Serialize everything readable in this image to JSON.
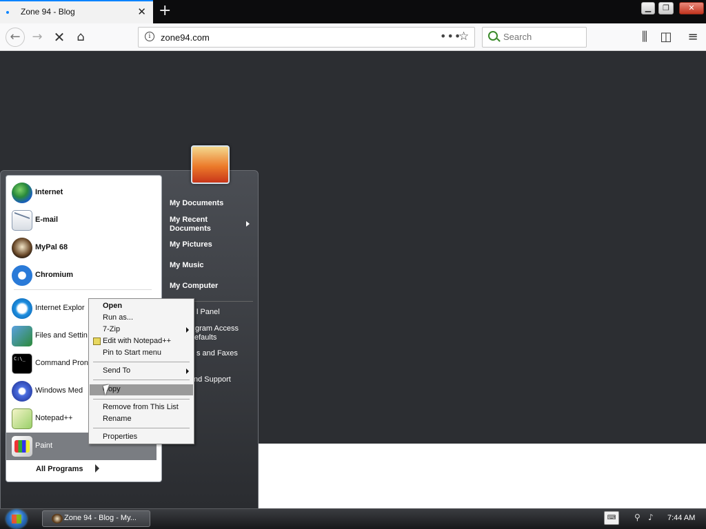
{
  "browser": {
    "tab_title": "Zone 94 - Blog",
    "tab_close": "✕",
    "new_tab": "+",
    "url": "zone94.com",
    "url_actions": "•••",
    "bookmark_star": "☆",
    "search_placeholder": "Search",
    "window_controls": {
      "minimize": "▁",
      "maximize": "❐",
      "close": "✕"
    },
    "nav_icons": {
      "back": "←",
      "forward": "→",
      "stop": "✕",
      "home": "⌂",
      "library": "⫼",
      "sidebar": "◫",
      "menu": "≡"
    }
  },
  "start_menu": {
    "pinned": [
      {
        "label": "Internet",
        "icon": "globe-icon"
      },
      {
        "label": "E-mail",
        "icon": "mail-icon"
      },
      {
        "label": "MyPal 68",
        "icon": "mypal-icon"
      },
      {
        "label": "Chromium",
        "icon": "chromium-icon"
      }
    ],
    "recent": [
      {
        "label": "Internet Explor",
        "icon": "ie-icon"
      },
      {
        "label": "Files and Settin",
        "icon": "files-settings-icon"
      },
      {
        "label": "Command Pron",
        "icon": "cmd-icon"
      },
      {
        "label": "Windows Med",
        "icon": "media-player-icon"
      },
      {
        "label": "Notepad++",
        "icon": "notepadpp-icon"
      },
      {
        "label": "Paint",
        "icon": "paint-icon"
      }
    ],
    "cmd_icon_text": "C:\\_",
    "all_programs": "All Programs",
    "right_links": [
      "My Documents",
      "My Recent Documents",
      "My Pictures",
      "My Music",
      "My Computer"
    ],
    "right_links_partial": [
      "l Panel",
      "gram Access",
      "efaults",
      "s and Faxes",
      "nd Support"
    ]
  },
  "context_menu": {
    "items": [
      {
        "label": "Open",
        "bold": true
      },
      {
        "label": "Run as..."
      },
      {
        "label": "7-Zip",
        "submenu": true
      },
      {
        "label": "Edit with Notepad++"
      },
      {
        "label": "Pin to Start menu"
      },
      {
        "label": "Send To",
        "submenu": true
      },
      {
        "label": "Copy",
        "highlighted": true
      },
      {
        "label": "Remove from This List"
      },
      {
        "label": "Rename"
      },
      {
        "label": "Properties"
      }
    ]
  },
  "taskbar": {
    "window_button": "Zone 94 - Blog - My...",
    "keyboard_icon": "⌨",
    "network_icon": "⚲",
    "volume_icon": "♪",
    "clock": "7:44 AM"
  }
}
